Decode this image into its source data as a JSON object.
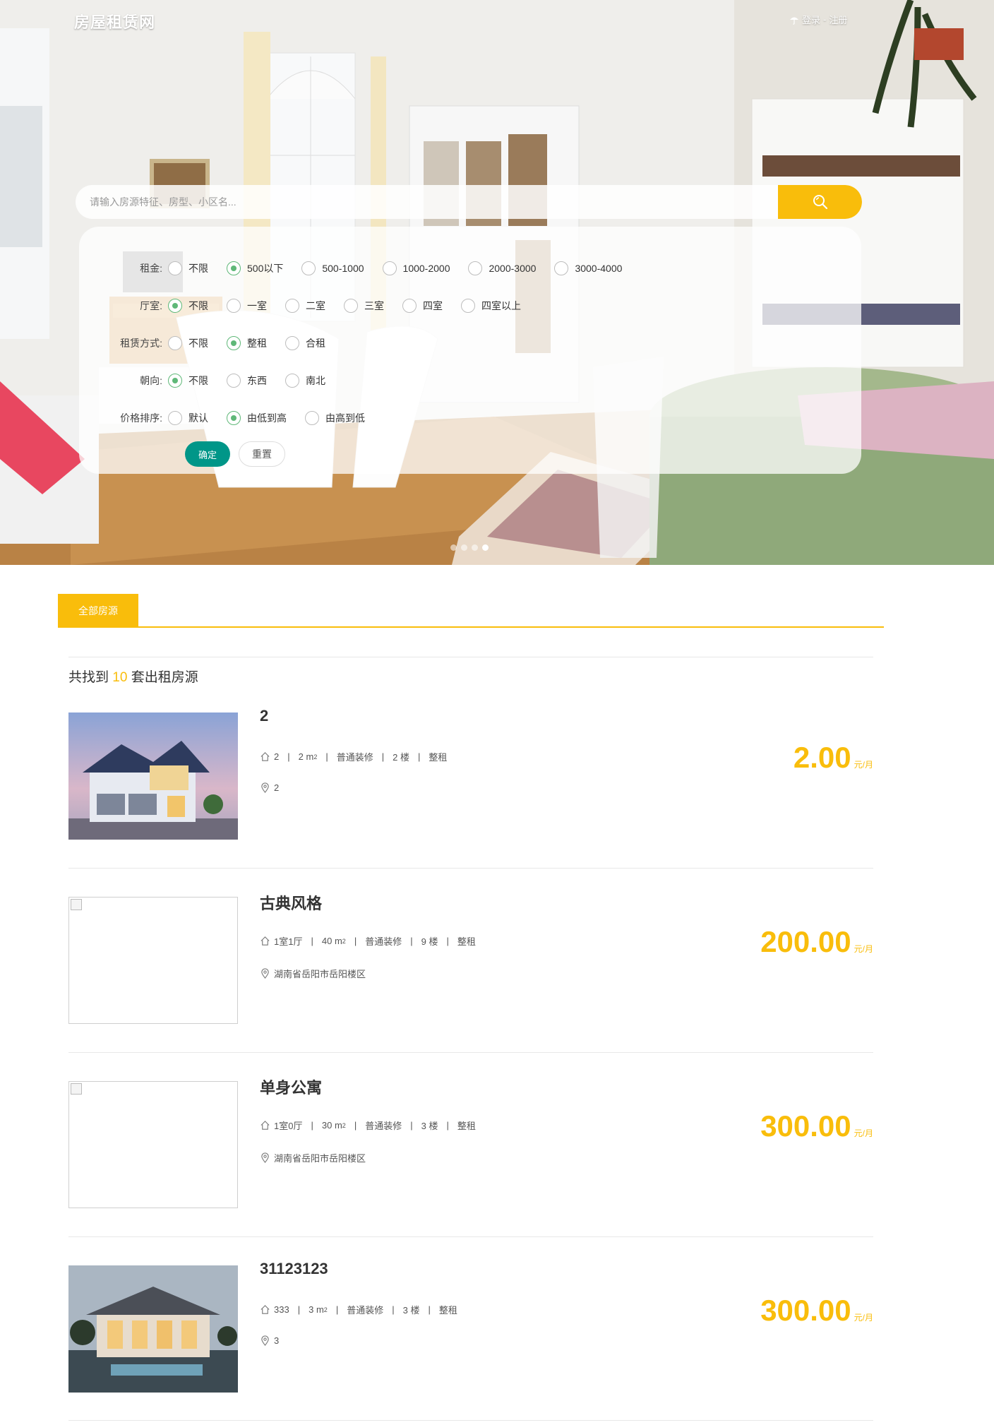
{
  "header": {
    "logo": "房屋租赁网",
    "login": "登录",
    "separator": " - ",
    "register": "注册"
  },
  "search": {
    "placeholder": "请输入房源特征、房型、小区名..."
  },
  "filters": {
    "rent": {
      "label": "租金:",
      "options": [
        "不限",
        "500以下",
        "500-1000",
        "1000-2000",
        "2000-3000",
        "3000-4000"
      ],
      "selected": "500以下"
    },
    "layout": {
      "label": "厅室:",
      "options": [
        "不限",
        "一室",
        "二室",
        "三室",
        "四室",
        "四室以上"
      ],
      "selected": "不限"
    },
    "rent_type": {
      "label": "租赁方式:",
      "options": [
        "不限",
        "整租",
        "合租"
      ],
      "selected": "整租"
    },
    "orientation": {
      "label": "朝向:",
      "options": [
        "不限",
        "东西",
        "南北"
      ],
      "selected": "不限"
    },
    "sort": {
      "label": "价格排序:",
      "options": [
        "默认",
        "由低到高",
        "由高到低"
      ],
      "selected": "由低到高"
    },
    "confirm_label": "确定",
    "reset_label": "重置"
  },
  "carousel": {
    "slides": 4,
    "active": 4
  },
  "tabs": {
    "all": "全部房源"
  },
  "result": {
    "prefix": "共找到",
    "count": "10",
    "suffix": "套出租房源"
  },
  "listings": [
    {
      "title": "2",
      "layout": "2",
      "area": "2",
      "area_unit": "m",
      "decoration": "普通装修",
      "floor": "2 楼",
      "rent_type": "整租",
      "address": "2",
      "price": "2.00",
      "unit": "元/月",
      "image": "house-blue-dusk"
    },
    {
      "title": "古典风格",
      "layout": "1室1厅",
      "area": "40",
      "area_unit": "m",
      "decoration": "普通装修",
      "floor": "9 楼",
      "rent_type": "整租",
      "address": "湖南省岳阳市岳阳楼区",
      "price": "200.00",
      "unit": "元/月",
      "image": "broken"
    },
    {
      "title": "单身公寓",
      "layout": "1室0厅",
      "area": "30",
      "area_unit": "m",
      "decoration": "普通装修",
      "floor": "3 楼",
      "rent_type": "整租",
      "address": "湖南省岳阳市岳阳楼区",
      "price": "300.00",
      "unit": "元/月",
      "image": "broken"
    },
    {
      "title": "31123123",
      "layout": "333",
      "area": "3",
      "area_unit": "m",
      "decoration": "普通装修",
      "floor": "3 楼",
      "rent_type": "整租",
      "address": "3",
      "price": "300.00",
      "unit": "元/月",
      "image": "villa-night"
    }
  ],
  "colors": {
    "accent": "#f9bd0b",
    "confirm": "#009688",
    "radio": "#5fb878"
  }
}
